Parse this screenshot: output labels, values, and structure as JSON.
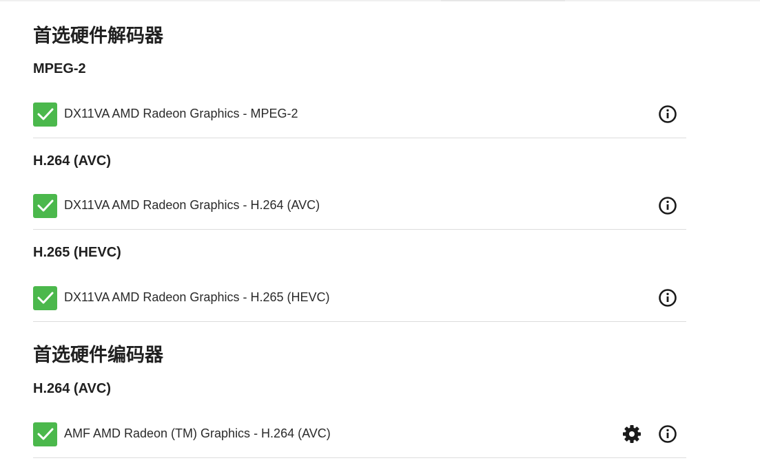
{
  "decoders": {
    "title": "首选硬件解码器",
    "groups": [
      {
        "codec": "MPEG-2",
        "item": "DX11VA AMD Radeon Graphics - MPEG-2",
        "checked": true
      },
      {
        "codec": "H.264 (AVC)",
        "item": "DX11VA AMD Radeon Graphics - H.264 (AVC)",
        "checked": true
      },
      {
        "codec": "H.265 (HEVC)",
        "item": "DX11VA AMD Radeon Graphics - H.265 (HEVC)",
        "checked": true
      }
    ]
  },
  "encoders": {
    "title": "首选硬件编码器",
    "groups": [
      {
        "codec": "H.264 (AVC)",
        "item": "AMF AMD Radeon (TM) Graphics - H.264 (AVC)",
        "checked": true,
        "has_settings": true
      }
    ]
  },
  "colors": {
    "checkbox_checked": "#4bb84c",
    "divider": "#dcdcdc",
    "text": "#202020"
  },
  "icons": {
    "checkbox": "check-icon",
    "info": "info-circle-icon",
    "settings": "gear-icon"
  }
}
